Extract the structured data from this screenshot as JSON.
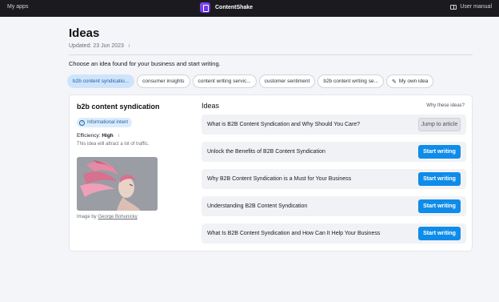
{
  "topbar": {
    "my_apps": "My apps",
    "brand": "ContentShake",
    "user_manual": "User manual"
  },
  "header": {
    "title": "Ideas",
    "updated": "Updated: 23 Jun 2023",
    "info": "i"
  },
  "prompt": "Choose an idea found for your business and start writing.",
  "chips": [
    {
      "label": "b2b content syndicatio...",
      "active": true
    },
    {
      "label": "consumer insights"
    },
    {
      "label": "content writing servic..."
    },
    {
      "label": "customer sentiment"
    },
    {
      "label": "b2b content writing se..."
    },
    {
      "label": "My own idea"
    }
  ],
  "topic": {
    "title": "b2b content syndication",
    "intent": "Informational intent",
    "efficiency_label": "Efficiency:",
    "efficiency_value": "High",
    "efficiency_note": "This idea will attract a lot of traffic.",
    "image_credit_prefix": "Image by",
    "image_credit_author": "George Bohunicky"
  },
  "ideas": {
    "title": "Ideas",
    "why_link": "Why these ideas?",
    "items": [
      {
        "text": "What is B2B Content Syndication and Why Should You Care?",
        "button": "Jump to article",
        "style": "secondary"
      },
      {
        "text": "Unlock the Benefits of B2B Content Syndication",
        "button": "Start writing",
        "style": "primary"
      },
      {
        "text": "Why B2B Content Syndication is a Must for Your Business",
        "button": "Start writing",
        "style": "primary"
      },
      {
        "text": "Understanding B2B Content Syndication",
        "button": "Start writing",
        "style": "primary"
      },
      {
        "text": "What Is B2B Content Syndication and How Can It Help Your Business",
        "button": "Start writing",
        "style": "primary"
      }
    ]
  }
}
